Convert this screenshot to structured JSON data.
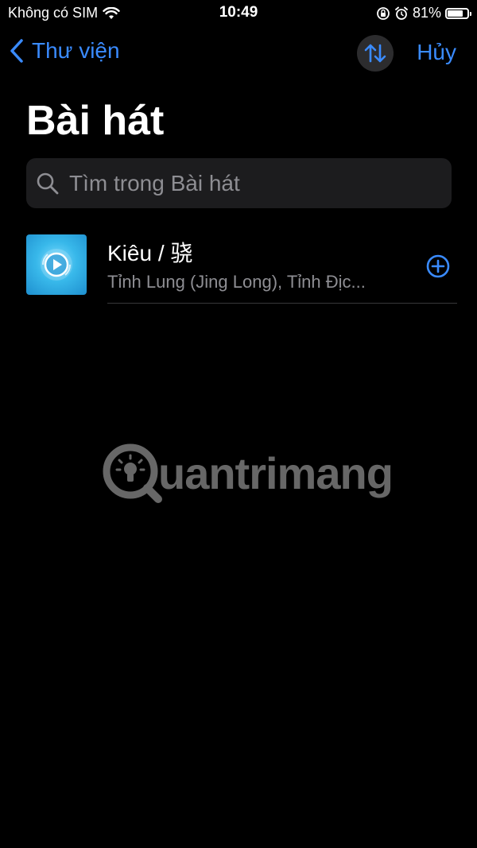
{
  "status_bar": {
    "carrier": "Không có SIM",
    "time": "10:49",
    "battery_percent": "81%",
    "battery_level": 0.81
  },
  "nav": {
    "back_label": "Thư viện",
    "cancel_label": "Hủy"
  },
  "page": {
    "title": "Bài hát"
  },
  "search": {
    "placeholder": "Tìm trong Bài hát"
  },
  "songs": [
    {
      "title": "Kiêu / 骁",
      "artist": "Tỉnh Lung (Jing Long), Tỉnh Địc..."
    }
  ],
  "watermark": {
    "text": "uantrimang"
  },
  "colors": {
    "accent": "#3a8bff",
    "background": "#000000",
    "secondary_text": "#8e8e93"
  }
}
